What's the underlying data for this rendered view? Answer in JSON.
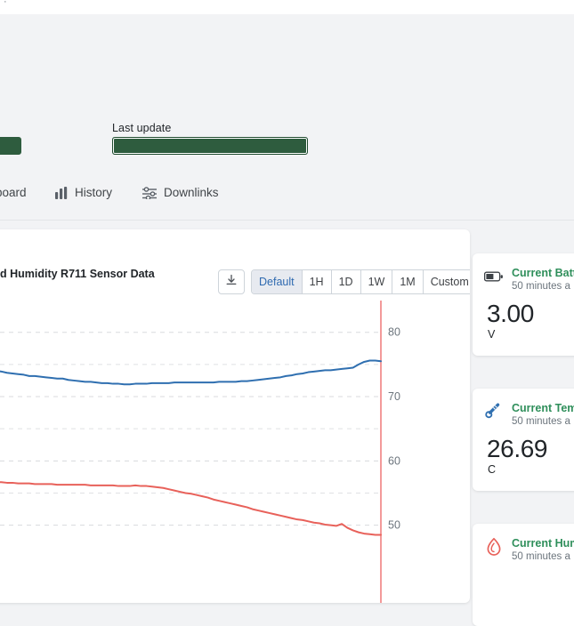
{
  "top": {
    "last_update_label": "Last update",
    "last_update_value": "",
    "tabs": [
      {
        "label": "board",
        "icon": "dashboard-icon"
      },
      {
        "label": "History",
        "icon": "bar-chart-icon"
      },
      {
        "label": "Downlinks",
        "icon": "sliders-icon"
      }
    ]
  },
  "chart_panel": {
    "title": "d Humidity R711 Sensor Data",
    "download_icon": "download-icon",
    "ranges": [
      {
        "label": "Default",
        "active": true
      },
      {
        "label": "1H",
        "active": false
      },
      {
        "label": "1D",
        "active": false
      },
      {
        "label": "1W",
        "active": false
      },
      {
        "label": "1M",
        "active": false
      },
      {
        "label": "Custom",
        "active": false
      }
    ]
  },
  "chart_data": {
    "type": "line",
    "title": "d Humidity R711 Sensor Data",
    "xlabel": "",
    "ylabel": "",
    "ylim": [
      40,
      83
    ],
    "yticks": [
      50,
      60,
      70,
      80
    ],
    "grid": true,
    "legend": "none",
    "axis_color": "#f08080",
    "series": [
      {
        "name": "Humidity",
        "color": "#2f6fb0",
        "values": [
          75.6,
          75.4,
          75.3,
          75.1,
          75.0,
          74.9,
          74.8,
          74.6,
          74.5,
          74.4,
          74.3,
          74.1,
          74.0,
          73.9,
          73.7,
          73.6,
          73.5,
          73.4,
          73.2,
          73.2,
          73.1,
          73.0,
          72.9,
          72.8,
          72.8,
          72.6,
          72.5,
          72.4,
          72.3,
          72.3,
          72.2,
          72.1,
          72.1,
          72.0,
          72.0,
          71.9,
          71.9,
          72.0,
          72.0,
          72.0,
          72.1,
          72.1,
          72.1,
          72.1,
          72.2,
          72.2,
          72.2,
          72.2,
          72.2,
          72.2,
          72.2,
          72.2,
          72.3,
          72.3,
          72.3,
          72.3,
          72.4,
          72.4,
          72.5,
          72.6,
          72.7,
          72.8,
          72.9,
          73.0,
          73.2,
          73.3,
          73.5,
          73.6,
          73.8,
          73.9,
          74.0,
          74.1,
          74.1,
          74.2,
          74.3,
          74.4,
          74.5,
          75.0,
          75.4,
          75.6,
          75.6,
          75.5
        ]
      },
      {
        "name": "Temperature",
        "color": "#e8615a",
        "values": [
          57.4,
          57.3,
          57.2,
          57.2,
          57.1,
          57.0,
          57.0,
          56.9,
          56.9,
          56.8,
          56.8,
          56.7,
          56.7,
          56.7,
          56.6,
          56.6,
          56.5,
          56.5,
          56.5,
          56.4,
          56.4,
          56.4,
          56.4,
          56.3,
          56.3,
          56.3,
          56.3,
          56.3,
          56.3,
          56.2,
          56.2,
          56.2,
          56.2,
          56.2,
          56.1,
          56.1,
          56.1,
          56.2,
          56.1,
          56.1,
          56.0,
          55.9,
          55.8,
          55.6,
          55.4,
          55.2,
          55.0,
          54.9,
          54.7,
          54.5,
          54.3,
          54.0,
          53.8,
          53.6,
          53.4,
          53.2,
          53.0,
          52.8,
          52.5,
          52.3,
          52.1,
          51.9,
          51.7,
          51.5,
          51.3,
          51.1,
          50.9,
          50.8,
          50.6,
          50.4,
          50.3,
          50.1,
          50.0,
          49.9,
          50.2,
          49.6,
          49.2,
          48.9,
          48.7,
          48.6,
          48.5,
          48.5
        ]
      }
    ]
  },
  "cards": [
    {
      "icon": "battery-icon",
      "title": "Current Batt",
      "subtitle": "50 minutes a",
      "value": "3.00",
      "unit": "V"
    },
    {
      "icon": "thermometer-icon",
      "title": "Current Tem",
      "subtitle": "50 minutes a",
      "value": "26.69",
      "unit": "C"
    },
    {
      "icon": "humidity-drop-icon",
      "title": "Current Hum",
      "subtitle": "50 minutes a",
      "value": "",
      "unit": ""
    }
  ]
}
